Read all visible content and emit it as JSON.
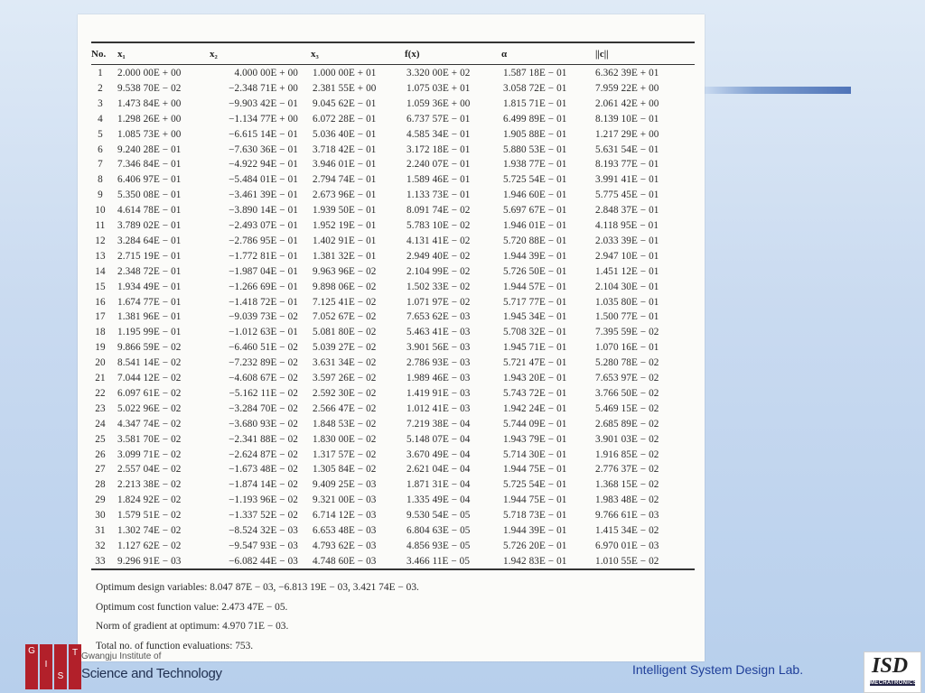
{
  "table": {
    "headers": {
      "no": "No.",
      "x1": "x₁",
      "x2": "x₂",
      "x3": "x₃",
      "fx": "f(x)",
      "alpha": "α",
      "norm": "||c||"
    },
    "rows": [
      [
        "1",
        "2.000 00E + 00",
        "4.000 00E + 00",
        "1.000 00E + 01",
        "3.320 00E + 02",
        "1.587 18E − 01",
        "6.362 39E + 01"
      ],
      [
        "2",
        "9.538 70E − 02",
        "−2.348 71E + 00",
        "2.381 55E + 00",
        "1.075 03E + 01",
        "3.058 72E − 01",
        "7.959 22E + 00"
      ],
      [
        "3",
        "1.473 84E + 00",
        "−9.903 42E − 01",
        "9.045 62E − 01",
        "1.059 36E + 00",
        "1.815 71E − 01",
        "2.061 42E + 00"
      ],
      [
        "4",
        "1.298 26E + 00",
        "−1.134 77E + 00",
        "6.072 28E − 01",
        "6.737 57E − 01",
        "6.499 89E − 01",
        "8.139 10E − 01"
      ],
      [
        "5",
        "1.085 73E + 00",
        "−6.615 14E − 01",
        "5.036 40E − 01",
        "4.585 34E − 01",
        "1.905 88E − 01",
        "1.217 29E + 00"
      ],
      [
        "6",
        "9.240 28E − 01",
        "−7.630 36E − 01",
        "3.718 42E − 01",
        "3.172 18E − 01",
        "5.880 53E − 01",
        "5.631 54E − 01"
      ],
      [
        "7",
        "7.346 84E − 01",
        "−4.922 94E − 01",
        "3.946 01E − 01",
        "2.240 07E − 01",
        "1.938 77E − 01",
        "8.193 77E − 01"
      ],
      [
        "8",
        "6.406 97E − 01",
        "−5.484 01E − 01",
        "2.794 74E − 01",
        "1.589 46E − 01",
        "5.725 54E − 01",
        "3.991 41E − 01"
      ],
      [
        "9",
        "5.350 08E − 01",
        "−3.461 39E − 01",
        "2.673 96E − 01",
        "1.133 73E − 01",
        "1.946 60E − 01",
        "5.775 45E − 01"
      ],
      [
        "10",
        "4.614 78E − 01",
        "−3.890 14E − 01",
        "1.939 50E − 01",
        "8.091 74E − 02",
        "5.697 67E − 01",
        "2.848 37E − 01"
      ],
      [
        "11",
        "3.789 02E − 01",
        "−2.493 07E − 01",
        "1.952 19E − 01",
        "5.783 10E − 02",
        "1.946 01E − 01",
        "4.118 95E − 01"
      ],
      [
        "12",
        "3.284 64E − 01",
        "−2.786 95E − 01",
        "1.402 91E − 01",
        "4.131 41E − 02",
        "5.720 88E − 01",
        "2.033 39E − 01"
      ],
      [
        "13",
        "2.715 19E − 01",
        "−1.772 81E − 01",
        "1.381 32E − 01",
        "2.949 40E − 02",
        "1.944 39E − 01",
        "2.947 10E − 01"
      ],
      [
        "14",
        "2.348 72E − 01",
        "−1.987 04E − 01",
        "9.963 96E − 02",
        "2.104 99E − 02",
        "5.726 50E − 01",
        "1.451 12E − 01"
      ],
      [
        "15",
        "1.934 49E − 01",
        "−1.266 69E − 01",
        "9.898 06E − 02",
        "1.502 33E − 02",
        "1.944 57E − 01",
        "2.104 30E − 01"
      ],
      [
        "16",
        "1.674 77E − 01",
        "−1.418 72E − 01",
        "7.125 41E − 02",
        "1.071 97E − 02",
        "5.717 77E − 01",
        "1.035 80E − 01"
      ],
      [
        "17",
        "1.381 96E − 01",
        "−9.039 73E − 02",
        "7.052 67E − 02",
        "7.653 62E − 03",
        "1.945 34E − 01",
        "1.500 77E − 01"
      ],
      [
        "18",
        "1.195 99E − 01",
        "−1.012 63E − 01",
        "5.081 80E − 02",
        "5.463 41E − 03",
        "5.708 32E − 01",
        "7.395 59E − 02"
      ],
      [
        "19",
        "9.866 59E − 02",
        "−6.460 51E − 02",
        "5.039 27E − 02",
        "3.901 56E − 03",
        "1.945 71E − 01",
        "1.070 16E − 01"
      ],
      [
        "20",
        "8.541 14E − 02",
        "−7.232 89E − 02",
        "3.631 34E − 02",
        "2.786 93E − 03",
        "5.721 47E − 01",
        "5.280 78E − 02"
      ],
      [
        "21",
        "7.044 12E − 02",
        "−4.608 67E − 02",
        "3.597 26E − 02",
        "1.989 46E − 03",
        "1.943 20E − 01",
        "7.653 97E − 02"
      ],
      [
        "22",
        "6.097 61E − 02",
        "−5.162 11E − 02",
        "2.592 30E − 02",
        "1.419 91E − 03",
        "5.743 72E − 01",
        "3.766 50E − 02"
      ],
      [
        "23",
        "5.022 96E − 02",
        "−3.284 70E − 02",
        "2.566 47E − 02",
        "1.012 41E − 03",
        "1.942 24E − 01",
        "5.469 15E − 02"
      ],
      [
        "24",
        "4.347 74E − 02",
        "−3.680 93E − 02",
        "1.848 53E − 02",
        "7.219 38E − 04",
        "5.744 09E − 01",
        "2.685 89E − 02"
      ],
      [
        "25",
        "3.581 70E − 02",
        "−2.341 88E − 02",
        "1.830 00E − 02",
        "5.148 07E − 04",
        "1.943 79E − 01",
        "3.901 03E − 02"
      ],
      [
        "26",
        "3.099 71E − 02",
        "−2.624 87E − 02",
        "1.317 57E − 02",
        "3.670 49E − 04",
        "5.714 30E − 01",
        "1.916 85E − 02"
      ],
      [
        "27",
        "2.557 04E − 02",
        "−1.673 48E − 02",
        "1.305 84E − 02",
        "2.621 04E − 04",
        "1.944 75E − 01",
        "2.776 37E − 02"
      ],
      [
        "28",
        "2.213 38E − 02",
        "−1.874 14E − 02",
        "9.409 25E − 03",
        "1.871 31E − 04",
        "5.725 54E − 01",
        "1.368 15E − 02"
      ],
      [
        "29",
        "1.824 92E − 02",
        "−1.193 96E − 02",
        "9.321 00E − 03",
        "1.335 49E − 04",
        "1.944 75E − 01",
        "1.983 48E − 02"
      ],
      [
        "30",
        "1.579 51E − 02",
        "−1.337 52E − 02",
        "6.714 12E − 03",
        "9.530 54E − 05",
        "5.718 73E − 01",
        "9.766 61E − 03"
      ],
      [
        "31",
        "1.302 74E − 02",
        "−8.524 32E − 03",
        "6.653 48E − 03",
        "6.804 63E − 05",
        "1.944 39E − 01",
        "1.415 34E − 02"
      ],
      [
        "32",
        "1.127 62E − 02",
        "−9.547 93E − 03",
        "4.793 62E − 03",
        "4.856 93E − 05",
        "5.726 20E − 01",
        "6.970 01E − 03"
      ],
      [
        "33",
        "9.296 91E − 03",
        "−6.082 44E − 03",
        "4.748 60E − 03",
        "3.466 11E − 05",
        "1.942 83E − 01",
        "1.010 55E − 02"
      ]
    ]
  },
  "notes": {
    "design_vars": "Optimum design variables: 8.047 87E − 03, −6.813 19E − 03, 3.421 74E − 03.",
    "cost": "Optimum cost function value: 2.473 47E − 05.",
    "gradient": "Norm of gradient at optimum: 4.970 71E − 03.",
    "evals": "Total no. of function evaluations: 753."
  },
  "footer": {
    "logo_letters": [
      "G",
      "I",
      "S",
      "T"
    ],
    "institute_partial": "Gwangju Institute of",
    "institute_line2": "Science and Technology",
    "lab_name": "Intelligent System Design Lab.",
    "isd_logo_text": "ISD",
    "isd_logo_sub": "MECHATRONICS"
  }
}
